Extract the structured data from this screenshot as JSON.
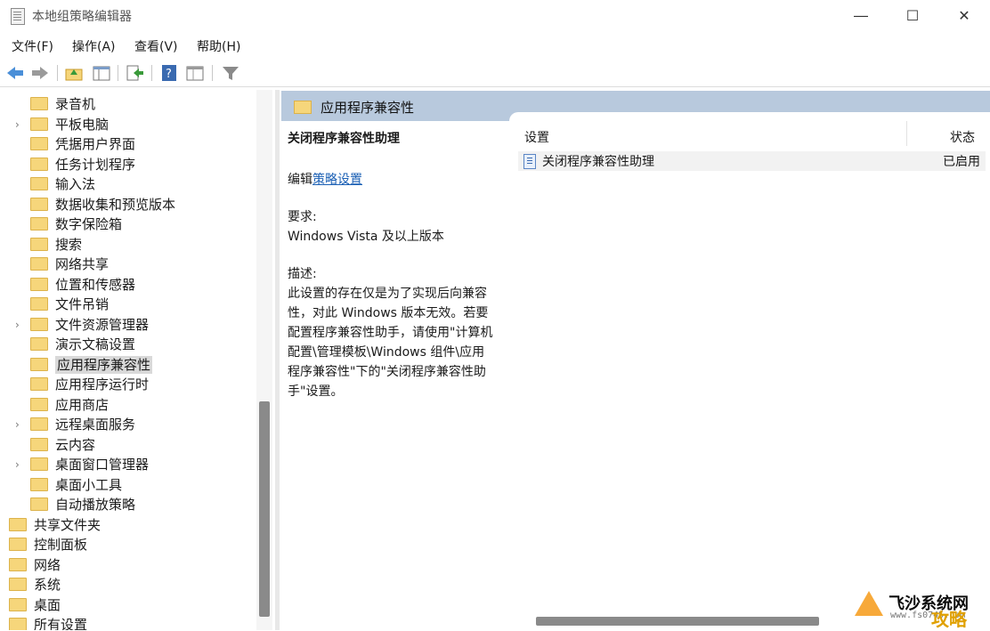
{
  "window": {
    "title": "本地组策略编辑器"
  },
  "menu": [
    "文件(F)",
    "操作(A)",
    "查看(V)",
    "帮助(H)"
  ],
  "tree": [
    {
      "label": "录音机",
      "expandable": false
    },
    {
      "label": "平板电脑",
      "expandable": true
    },
    {
      "label": "凭据用户界面",
      "expandable": false
    },
    {
      "label": "任务计划程序",
      "expandable": false
    },
    {
      "label": "输入法",
      "expandable": false
    },
    {
      "label": "数据收集和预览版本",
      "expandable": false
    },
    {
      "label": "数字保险箱",
      "expandable": false
    },
    {
      "label": "搜索",
      "expandable": false
    },
    {
      "label": "网络共享",
      "expandable": false
    },
    {
      "label": "位置和传感器",
      "expandable": false
    },
    {
      "label": "文件吊销",
      "expandable": false
    },
    {
      "label": "文件资源管理器",
      "expandable": true
    },
    {
      "label": "演示文稿设置",
      "expandable": false
    },
    {
      "label": "应用程序兼容性",
      "expandable": false,
      "selected": true
    },
    {
      "label": "应用程序运行时",
      "expandable": false
    },
    {
      "label": "应用商店",
      "expandable": false
    },
    {
      "label": "远程桌面服务",
      "expandable": true
    },
    {
      "label": "云内容",
      "expandable": false
    },
    {
      "label": "桌面窗口管理器",
      "expandable": true
    },
    {
      "label": "桌面小工具",
      "expandable": false
    },
    {
      "label": "自动播放策略",
      "expandable": false
    }
  ],
  "tree_root": [
    "共享文件夹",
    "控制面板",
    "网络",
    "系统",
    "桌面",
    "所有设置"
  ],
  "right_header": "应用程序兼容性",
  "description": {
    "title": "关闭程序兼容性助理",
    "edit_prefix": "编辑",
    "edit_link": "策略设置",
    "requirements_label": "要求:",
    "requirements": "Windows Vista 及以上版本",
    "description_label": "描述:",
    "description_lines": [
      "此设置的存在仅是为了实现后向兼容",
      "性，对此 Windows 版本无效。若要",
      "配置程序兼容性助手，请使用\"计算机",
      "配置\\管理模板\\Windows 组件\\应用",
      "程序兼容性\"下的\"关闭程序兼容性助",
      "手\"设置。"
    ]
  },
  "list": {
    "columns": [
      "设置",
      "状态"
    ],
    "rows": [
      {
        "name": "关闭程序兼容性助理",
        "state": "已启用"
      }
    ]
  },
  "watermark": {
    "text1": "飞沙系统网",
    "text2": "www.fs0745.com",
    "text3": "攻略"
  }
}
